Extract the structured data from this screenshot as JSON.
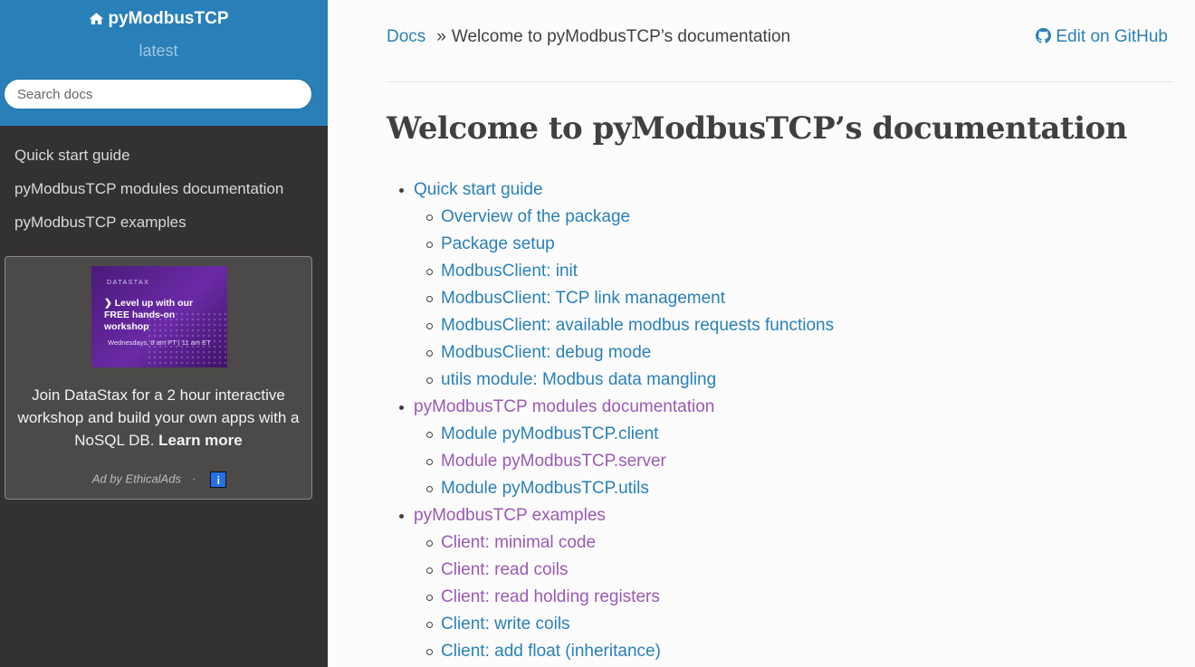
{
  "sidebar": {
    "brand": "pyModbusTCP",
    "version": "latest",
    "search_placeholder": "Search docs",
    "nav": [
      "Quick start guide",
      "pyModbusTCP modules documentation",
      "pyModbusTCP examples"
    ],
    "ad": {
      "image_brand": "DATASTAX",
      "image_headline": "❯ Level up with our FREE hands-on workshop",
      "image_when": "Wednesdays, 8 am PT | 11 am ET",
      "text": "Join DataStax for a 2 hour interactive workshop and build your own apps with a NoSQL DB.",
      "link": "Learn more",
      "by": "Ad by EthicalAds",
      "separator": "·",
      "info_icon": "i"
    }
  },
  "breadcrumb": {
    "root": "Docs",
    "separator": "»",
    "current": "Welcome to pyModbusTCP’s documentation"
  },
  "github_link": "Edit on GitHub",
  "page_title": "Welcome to pyModbusTCP’s documentation",
  "toc": [
    {
      "text": "Quick start guide",
      "visited": false
    },
    {
      "text": "Overview of the package",
      "visited": false
    },
    {
      "text": "Package setup",
      "visited": false
    },
    {
      "text": "ModbusClient: init",
      "visited": false
    },
    {
      "text": "ModbusClient: TCP link management",
      "visited": false
    },
    {
      "text": "ModbusClient: available modbus requests functions",
      "visited": false
    },
    {
      "text": "ModbusClient: debug mode",
      "visited": false
    },
    {
      "text": "utils module: Modbus data mangling",
      "visited": false
    },
    {
      "text": "pyModbusTCP modules documentation",
      "visited": true
    },
    {
      "text": "Module pyModbusTCP.client",
      "visited": false
    },
    {
      "text": "Module pyModbusTCP.server",
      "visited": true
    },
    {
      "text": "Module pyModbusTCP.utils",
      "visited": false
    },
    {
      "text": "pyModbusTCP examples",
      "visited": true
    },
    {
      "text": "Client: minimal code",
      "visited": true
    },
    {
      "text": "Client: read coils",
      "visited": true
    },
    {
      "text": "Client: read holding registers",
      "visited": true
    },
    {
      "text": "Client: write coils",
      "visited": false
    },
    {
      "text": "Client: add float (inheritance)",
      "visited": false
    }
  ],
  "colors": {
    "link": "#2980b9",
    "visited": "#9b59b6",
    "sidebar_top": "#2980b9",
    "sidebar_bg": "#343131"
  },
  "icons": {
    "brand": "home-icon",
    "github": "github-icon"
  }
}
